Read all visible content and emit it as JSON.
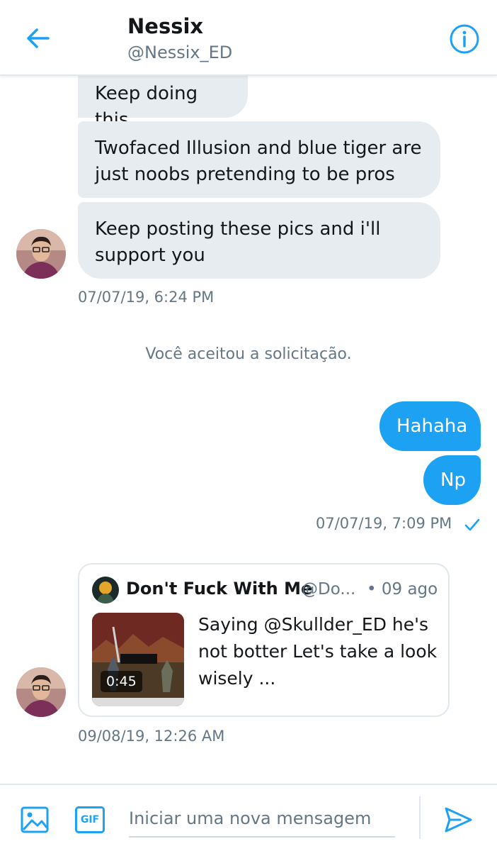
{
  "header": {
    "name": "Nessix",
    "handle": "@Nessix_ED"
  },
  "messages": {
    "incoming_group_1": [
      "Keep doing this",
      "Twofaced Illusion and blue tiger are just noobs pretending to be pros",
      "Keep posting these pics and i'll support you"
    ],
    "incoming_group_1_timestamp": "07/07/19, 6:24 PM",
    "system_notice": "Você aceitou a solicitação.",
    "outgoing_group": [
      "Hahaha",
      "Np"
    ],
    "outgoing_timestamp": "07/07/19, 7:09 PM",
    "shared_tweet": {
      "author_name": "Don't Fuck With Me",
      "author_handle": "@Do...",
      "time": "• 09 ago",
      "video_duration": "0:45",
      "text": "Saying @Skullder_ED he's not botter Let's take a look wisely ..."
    },
    "incoming_group_2_timestamp": "09/08/19, 12:26 AM"
  },
  "composer": {
    "gif_label": "GIF",
    "placeholder": "Iniciar uma nova mensagem"
  },
  "colors": {
    "accent": "#1da1f2",
    "incoming_bubble": "#e6ecf0",
    "secondary_text": "#657786"
  },
  "icons": {
    "back": "arrow-left-icon",
    "info": "info-circle-icon",
    "read": "checkmark-icon",
    "image": "image-icon",
    "send": "send-icon"
  }
}
